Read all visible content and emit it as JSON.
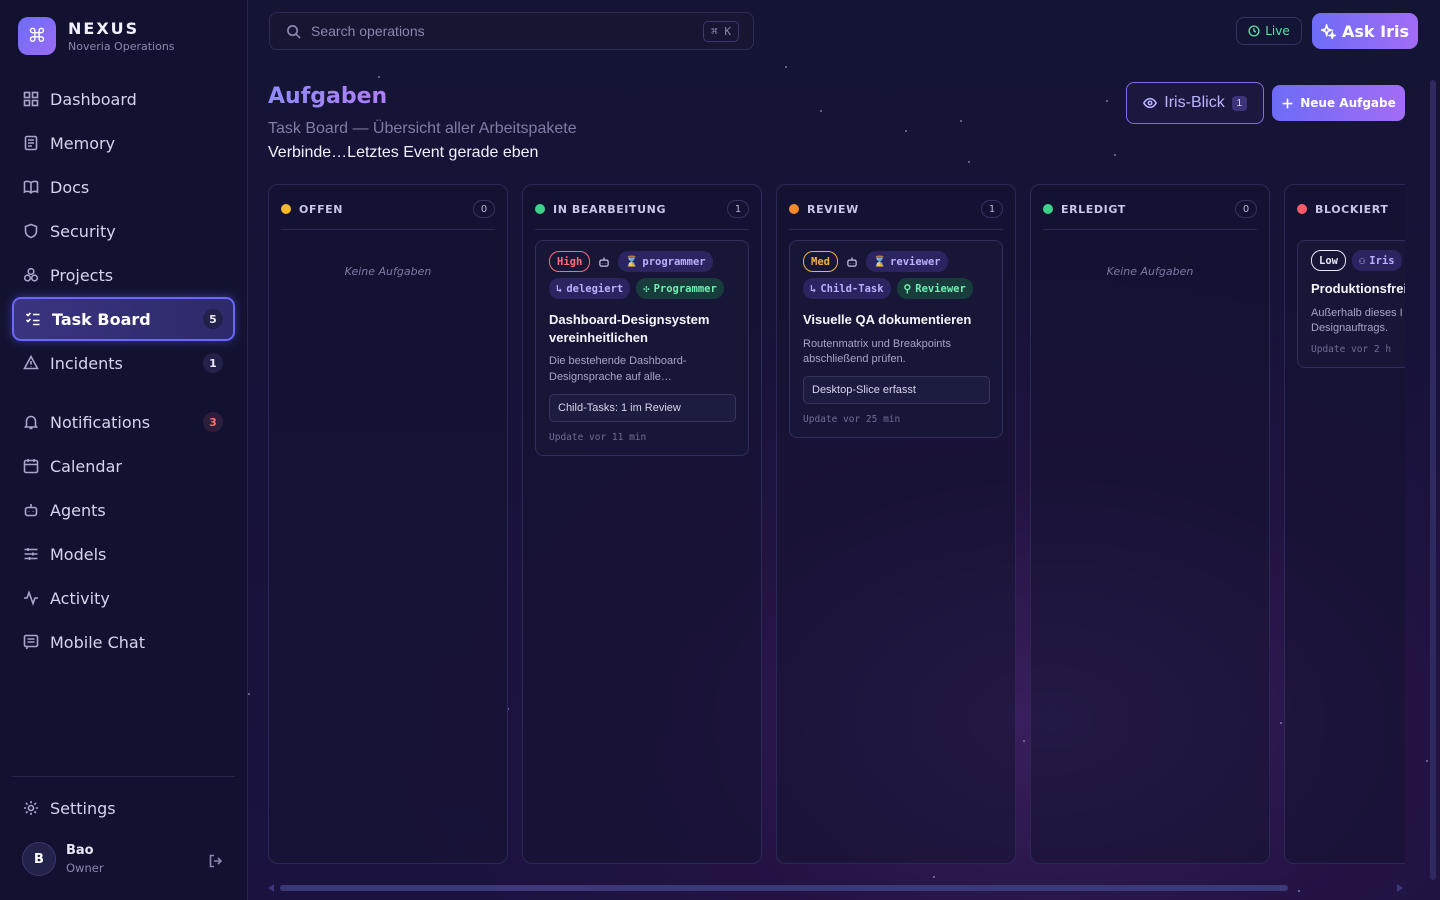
{
  "brand": {
    "name": "NEXUS",
    "subtitle": "Noveria Operations",
    "logo_icon": "command-icon"
  },
  "sidebar": {
    "items": [
      {
        "label": "Dashboard",
        "icon": "dashboard-icon"
      },
      {
        "label": "Memory",
        "icon": "memory-icon"
      },
      {
        "label": "Docs",
        "icon": "book-icon"
      },
      {
        "label": "Security",
        "icon": "shield-icon"
      },
      {
        "label": "Projects",
        "icon": "projects-icon"
      },
      {
        "label": "Task Board",
        "icon": "checklist-icon",
        "badge": "5",
        "active": true
      },
      {
        "label": "Incidents",
        "icon": "warning-icon",
        "badge": "1"
      },
      {
        "label": "Notifications",
        "icon": "bell-icon",
        "badge": "3"
      },
      {
        "label": "Calendar",
        "icon": "calendar-icon"
      },
      {
        "label": "Agents",
        "icon": "bot-icon"
      },
      {
        "label": "Models",
        "icon": "sliders-icon"
      },
      {
        "label": "Activity",
        "icon": "activity-icon"
      },
      {
        "label": "Mobile Chat",
        "icon": "chat-icon"
      }
    ],
    "settings": "Settings",
    "user": {
      "initial": "B",
      "name": "Bao",
      "role": "Owner"
    }
  },
  "topbar": {
    "search_placeholder": "Search operations",
    "shortcut": "⌘ K",
    "live": "Live",
    "ask": "Ask Iris"
  },
  "header": {
    "title": "Aufgaben",
    "subtitle": "Task Board — Übersicht aller Arbeitspakete",
    "status": "Verbinde…Letztes Event gerade eben",
    "iris_blick": "Iris-Blick",
    "iris_blick_count": "1",
    "new_task": "Neue Aufgabe"
  },
  "colors": {
    "accent": "#6d6cf7",
    "accent2": "#a36cf5",
    "offen": "#f5b82a",
    "in_bearbeitung": "#3ed18a",
    "review": "#f58a2a",
    "erledigt": "#3ed18a",
    "blockiert": "#ff5a6a"
  },
  "columns": [
    {
      "title": "OFFEN",
      "count": "0",
      "empty": "Keine Aufgaben"
    },
    {
      "title": "IN BEARBEITUNG",
      "count": "1"
    },
    {
      "title": "REVIEW",
      "count": "1"
    },
    {
      "title": "ERLEDIGT",
      "count": "0",
      "empty": "Keine Aufgaben"
    },
    {
      "title": "BLOCKIERT"
    }
  ],
  "cards": {
    "in_progress": {
      "priority": "High",
      "agent": "programmer",
      "delegated": "delegiert",
      "role": "Programmer",
      "title": "Dashboard-Designsystem vereinheitlichen",
      "desc": "Die bestehende Dashboard-Designsprache auf alle…",
      "box": "Child-Tasks: 1 im Review",
      "update": "Update vor 11 min"
    },
    "review": {
      "priority": "Med",
      "agent": "reviewer",
      "child": "Child-Task",
      "role": "Reviewer",
      "title": "Visuelle QA dokumentieren",
      "desc": "Routenmatrix und Breakpoints abschließend prüfen.",
      "box": "Desktop-Slice erfasst",
      "update": "Update vor 25 min"
    },
    "blocked": {
      "priority": "Low",
      "agent": "Iris",
      "title": "Produktionsfrei",
      "desc": "Außerhalb dieses I Designauftrags.",
      "update": "Update vor 2 h"
    }
  }
}
